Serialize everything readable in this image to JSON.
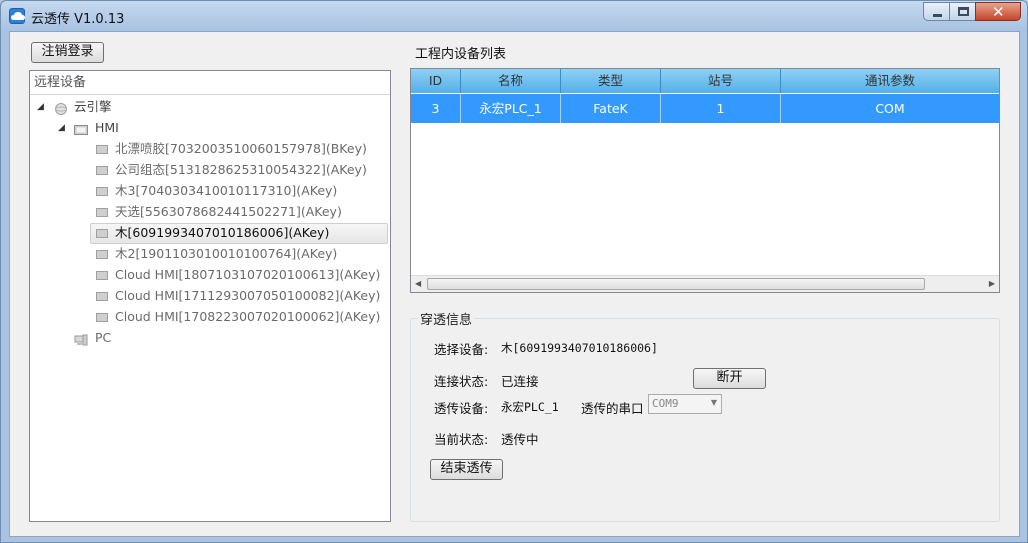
{
  "window": {
    "title": "云透传 V1.0.13",
    "controls": {
      "minimize": "minimize",
      "maximize": "maximize",
      "close": "✕"
    }
  },
  "toolbar": {
    "logout_label": "注销登录"
  },
  "remote_panel": {
    "header": "远程设备",
    "root": {
      "label": "云引擎"
    },
    "hmi_group": {
      "label": "HMI"
    },
    "devices": [
      {
        "label": "北漂喷胶[7032003510060157978](BKey)"
      },
      {
        "label": "公司组态[5131828625310054322](AKey)"
      },
      {
        "label": "木3[7040303410010117310](AKey)"
      },
      {
        "label": "天选[5563078682441502271](AKey)"
      },
      {
        "label": "木[6091993407010186006](AKey)",
        "selected": true
      },
      {
        "label": "木2[1901103010010100764](AKey)"
      },
      {
        "label": "Cloud HMI[1807103107020100613](AKey)"
      },
      {
        "label": "Cloud HMI[1711293007050100082](AKey)"
      },
      {
        "label": "Cloud HMI[1708223007020100062](AKey)"
      }
    ],
    "pc_group": {
      "label": "PC"
    }
  },
  "device_list": {
    "title": "工程内设备列表",
    "columns": [
      "ID",
      "名称",
      "类型",
      "站号",
      "通讯参数"
    ],
    "rows": [
      {
        "id": "3",
        "name": "永宏PLC_1",
        "type": "FateK",
        "station": "1",
        "comm": "COM"
      }
    ]
  },
  "passthrough": {
    "title": "穿透信息",
    "selected_device_label": "选择设备:",
    "selected_device_value": "木[6091993407010186006]",
    "connection_status_label": "连接状态:",
    "connection_status_value": "已连接",
    "disconnect_button": "断开",
    "passthrough_device_label": "透传设备:",
    "passthrough_device_value": "永宏PLC_1",
    "serial_port_label": "透传的串口",
    "serial_port_value": "COM9",
    "current_status_label": "当前状态:",
    "current_status_value": "透传中",
    "end_button": "结束透传"
  },
  "colors": {
    "selection": "#3399ff",
    "header_gradient_top": "#8fd0f5",
    "header_gradient_bottom": "#53b0e8"
  }
}
